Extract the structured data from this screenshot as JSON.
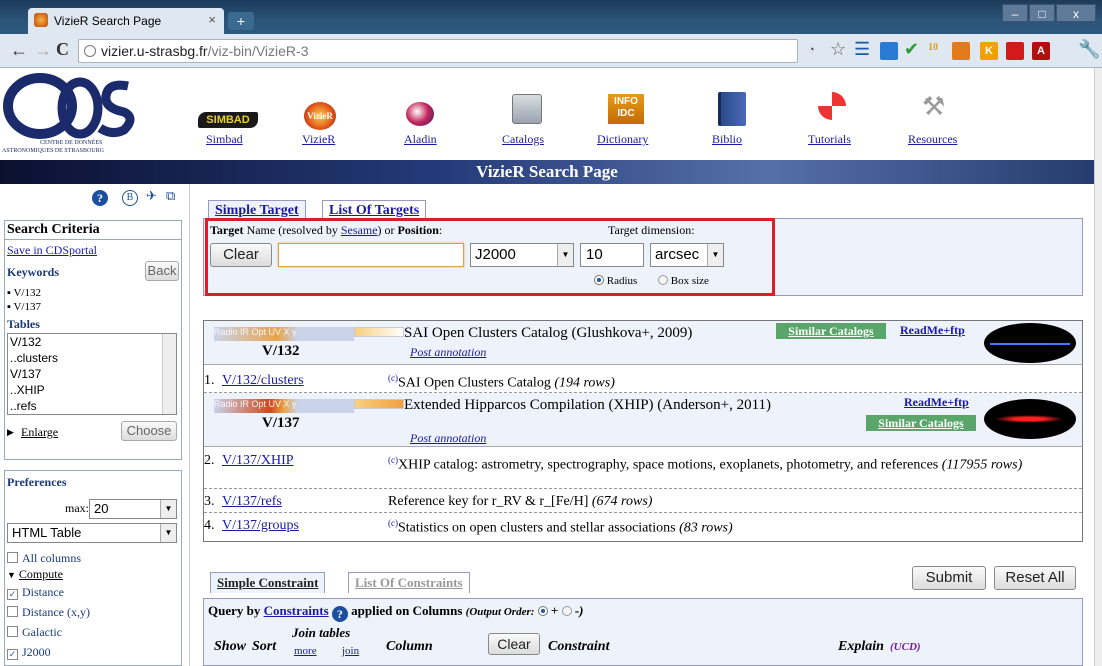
{
  "browser": {
    "tab_title": "VizieR Search Page",
    "tab_close": "×",
    "new_tab": "+",
    "url_host": "vizier.u-strasbg.fr",
    "url_path": "/viz-bin/VizieR-3",
    "window_controls": [
      "–",
      "□",
      "x"
    ]
  },
  "header": {
    "nav": [
      {
        "label": "Simbad",
        "icon": "simbad-logo-icon"
      },
      {
        "label": "VizieR",
        "icon": "vizier-logo-icon"
      },
      {
        "label": "Aladin",
        "icon": "aladin-logo-icon"
      },
      {
        "label": "Catalogs",
        "icon": "catalogs-icon"
      },
      {
        "label": "Dictionary",
        "icon": "dictionary-icon"
      },
      {
        "label": "Biblio",
        "icon": "book-icon"
      },
      {
        "label": "Tutorials",
        "icon": "lifebuoy-icon"
      },
      {
        "label": "Resources",
        "icon": "tools-icon"
      }
    ],
    "cds_logo_line1": "CENTRE DE DONNÉES",
    "cds_logo_line2": "ASTRONOMIQUES DE STRASBOURG",
    "page_title": "VizieR Search Page"
  },
  "sidebar": {
    "search_criteria": "Search Criteria",
    "save_link": "Save in CDSportal",
    "keywords_label": "Keywords",
    "back_button": "Back",
    "keywords": [
      "V/132",
      "V/137"
    ],
    "tables_label": "Tables",
    "tables_list": [
      "V/132",
      "..clusters",
      "V/137",
      "..XHIP",
      "..refs"
    ],
    "enlarge": "Enlarge",
    "choose_button": "Choose",
    "preferences_label": "Preferences",
    "max_label": "max:",
    "max_value": "20",
    "format_value": "HTML Table",
    "all_columns": "All columns",
    "compute_label": "Compute",
    "compute_items": [
      {
        "label": "Distance",
        "checked": true
      },
      {
        "label": "Distance (x,y)",
        "checked": false
      },
      {
        "label": "Galactic",
        "checked": false
      },
      {
        "label": "J2000",
        "checked": true
      }
    ]
  },
  "target_tabs": {
    "simple": "Simple Target",
    "list": "List Of Targets"
  },
  "target_form": {
    "target_label_bold": "Target",
    "target_label_rest": " Name (resolved by ",
    "sesame": "Sesame",
    "or": ") or ",
    "position": "Position",
    "colon": ":",
    "dimension_label": "Target dimension:",
    "clear_button": "Clear",
    "target_value": "",
    "epoch": "J2000",
    "dimension_value": "10",
    "unit": "arcsec",
    "radius_label": "Radius",
    "box_label": "Box size"
  },
  "results": {
    "cat1": {
      "id": "V/132",
      "title": "SAI Open Clusters Catalog (Glushkova+, 2009)",
      "annotation": "Post annotation",
      "similar": "Similar Catalogs",
      "readme": "ReadMe+ftp",
      "bands": "Radio  IR  Opt  UV  X  γ"
    },
    "row1": {
      "num": "1.",
      "link": "V/132/clusters",
      "text": "SAI Open Clusters Catalog",
      "rows": "(194 rows)"
    },
    "cat2": {
      "id": "V/137",
      "title": "Extended Hipparcos Compilation (XHIP) (Anderson+, 2011)",
      "annotation": "Post annotation",
      "similar": "Similar Catalogs",
      "readme": "ReadMe+ftp",
      "bands": "Radio  IR  Opt  UV  X  γ"
    },
    "row2": {
      "num": "2.",
      "link": "V/137/XHIP",
      "text": "XHIP catalog: astrometry, spectrography, space motions, exoplanets, photometry, and references",
      "rows": "(117955 rows)"
    },
    "row3": {
      "num": "3.",
      "link": "V/137/refs",
      "text": "Reference key for r_RV & r_[Fe/H]",
      "rows": "(674 rows)"
    },
    "row4": {
      "num": "4.",
      "link": "V/137/groups",
      "text": "Statistics on open clusters and stellar associations",
      "rows": "(83 rows)"
    },
    "copyright": "(c)"
  },
  "constraints": {
    "simple_tab": "Simple Constraint",
    "list_tab": "List Of Constraints",
    "submit": "Submit",
    "reset": "Reset All",
    "query_by": "Query by ",
    "constraints_link": "Constraints",
    "applied": " applied on Columns ",
    "output_order": "(Output Order:",
    "plus": "+",
    "minus": "-)",
    "show": "Show",
    "sort": "Sort",
    "join_tables": "Join tables",
    "more": "more",
    "join": "join",
    "column": "Column",
    "clear": "Clear",
    "constraint": "Constraint",
    "explain": "Explain",
    "ucd": "(UCD)"
  }
}
